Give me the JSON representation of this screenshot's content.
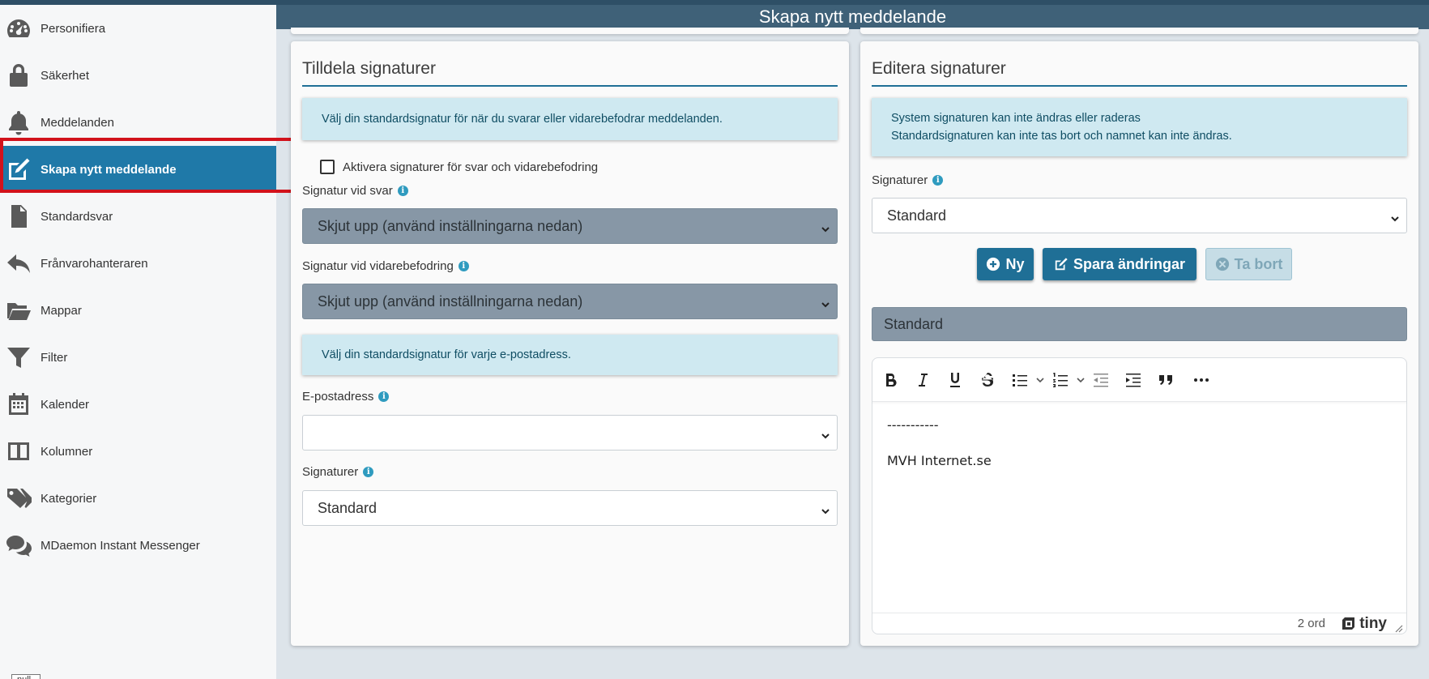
{
  "header": {
    "title": "Skapa nytt meddelande"
  },
  "sidebar": {
    "items": [
      {
        "label": "Personifiera",
        "icon": "speedometer-icon",
        "active": false
      },
      {
        "label": "Säkerhet",
        "icon": "lock-icon",
        "active": false
      },
      {
        "label": "Meddelanden",
        "icon": "bell-icon",
        "active": false
      },
      {
        "label": "Skapa nytt meddelande",
        "icon": "edit-icon",
        "active": true
      },
      {
        "label": "Standardsvar",
        "icon": "document-icon",
        "active": false
      },
      {
        "label": "Frånvarohanteraren",
        "icon": "reply-icon",
        "active": false
      },
      {
        "label": "Mappar",
        "icon": "folder-icon",
        "active": false
      },
      {
        "label": "Filter",
        "icon": "filter-icon",
        "active": false
      },
      {
        "label": "Kalender",
        "icon": "calendar-icon",
        "active": false
      },
      {
        "label": "Kolumner",
        "icon": "columns-icon",
        "active": false
      },
      {
        "label": "Kategorier",
        "icon": "tags-icon",
        "active": false
      },
      {
        "label": "MDaemon Instant Messenger",
        "icon": "chat-icon",
        "active": false
      }
    ],
    "footer_null": "null"
  },
  "left_panel": {
    "title": "Tilldela signaturer",
    "alert1": "Välj din standardsignatur för när du svarar eller vidarebefodrar meddelanden.",
    "checkbox_label": "Aktivera signaturer för svar och vidarebefodring",
    "checkbox_checked": false,
    "reply_label": "Signatur vid svar",
    "reply_value": "Skjut upp (använd inställningarna nedan)",
    "forward_label": "Signatur vid vidarebefodring",
    "forward_value": "Skjut upp (använd inställningarna nedan)",
    "alert2": "Välj din standardsignatur för varje e-postadress.",
    "email_label": "E-postadress",
    "email_value": "",
    "signatures_label": "Signaturer",
    "signatures_value": "Standard"
  },
  "right_panel": {
    "title": "Editera signaturer",
    "alert_line1": "System signaturen kan inte ändras eller raderas",
    "alert_line2": "Standardsignaturen kan inte tas bort och namnet kan inte ändras.",
    "signatures_label": "Signaturer",
    "signatures_value": "Standard",
    "buttons": {
      "new": "Ny",
      "save": "Spara ändringar",
      "delete": "Ta bort"
    },
    "name_value": "Standard",
    "editor": {
      "line1": "-----------",
      "line2": "MVH Internet.se",
      "word_count": "2 ord",
      "brand": "tiny"
    }
  },
  "colors": {
    "accent": "#1f79a8",
    "header": "#3f6178",
    "alert_bg": "#cfe9f1",
    "disabled_select": "#8797a6",
    "highlight": "#d2121b"
  }
}
